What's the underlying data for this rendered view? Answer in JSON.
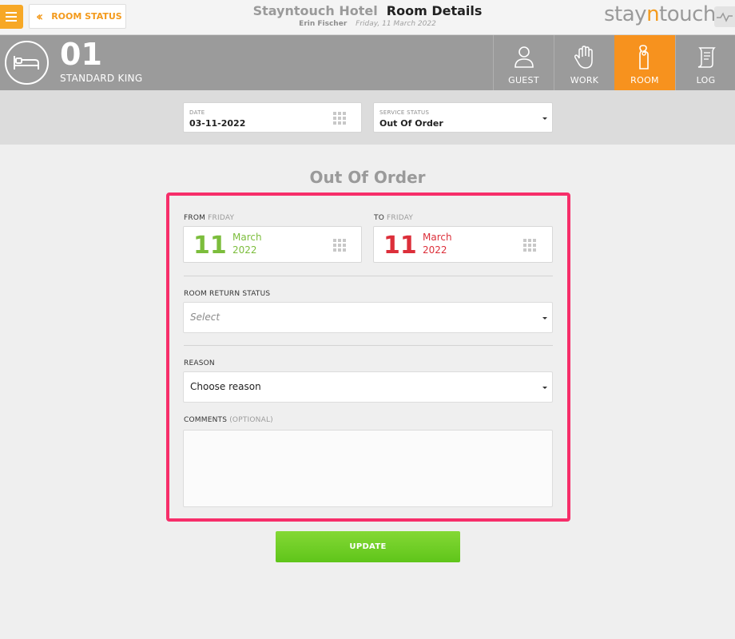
{
  "header": {
    "back_label": "ROOM STATUS",
    "hotel_name": "Stayntouch Hotel",
    "page_title": "Room Details",
    "user_name": "Erin Fischer",
    "date": "Friday, 11 March 2022",
    "logo_part1": "stay",
    "logo_part2": "n",
    "logo_part3": "touch"
  },
  "room": {
    "number": "01",
    "type": "STANDARD KING"
  },
  "tabs": [
    {
      "label": "GUEST",
      "icon": "person-icon",
      "active": false
    },
    {
      "label": "WORK",
      "icon": "hand-icon",
      "active": false
    },
    {
      "label": "ROOM",
      "icon": "door-hanger-icon",
      "active": true
    },
    {
      "label": "LOG",
      "icon": "scroll-icon",
      "active": false
    }
  ],
  "filters": {
    "date_label": "DATE",
    "date_value": "03-11-2022",
    "service_label": "SERVICE STATUS",
    "service_value": "Out Of Order"
  },
  "form": {
    "title": "Out Of Order",
    "from_label": "FROM",
    "from_weekday": "FRIDAY",
    "from_day": "11",
    "from_month": "March",
    "from_year": "2022",
    "to_label": "TO",
    "to_weekday": "FRIDAY",
    "to_day": "11",
    "to_month": "March",
    "to_year": "2022",
    "return_status_label": "ROOM RETURN STATUS",
    "return_status_placeholder": "Select",
    "reason_label": "REASON",
    "reason_value": "Choose reason",
    "comments_label": "COMMENTS",
    "comments_optional": "(OPTIONAL)",
    "comments_value": "",
    "update_label": "UPDATE"
  },
  "colors": {
    "accent": "#f7921e",
    "highlight": "#f72e6a",
    "from_color": "#7cbd3c",
    "to_color": "#dc2f3a",
    "update_button": "#6cce24"
  }
}
